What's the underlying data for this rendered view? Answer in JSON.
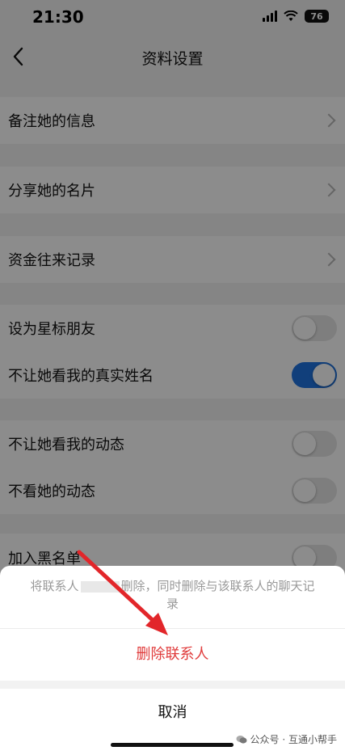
{
  "status_bar": {
    "time": "21:30",
    "battery": "76"
  },
  "nav": {
    "title": "资料设置"
  },
  "rows": {
    "remark": "备注她的信息",
    "share_card": "分享她的名片",
    "money_records": "资金往来记录",
    "star_friend": "设为星标朋友",
    "hide_real_name": "不让她看我的真实姓名",
    "hide_my_moments": "不让她看我的动态",
    "hide_her_moments": "不看她的动态",
    "blacklist": "加入黑名单"
  },
  "toggles": {
    "star_friend": false,
    "hide_real_name": true,
    "hide_my_moments": false,
    "hide_her_moments": false,
    "blacklist": false
  },
  "sheet": {
    "message_prefix": "将联系人",
    "message_suffix": "删除，同时删除与该联系人的聊天记录",
    "delete_label": "删除联系人",
    "cancel_label": "取消"
  },
  "watermark": {
    "text": "公众号 · 互通小帮手"
  },
  "colors": {
    "accent": "#1f73e0",
    "danger": "#e03b3b",
    "arrow": "#e2262a"
  }
}
